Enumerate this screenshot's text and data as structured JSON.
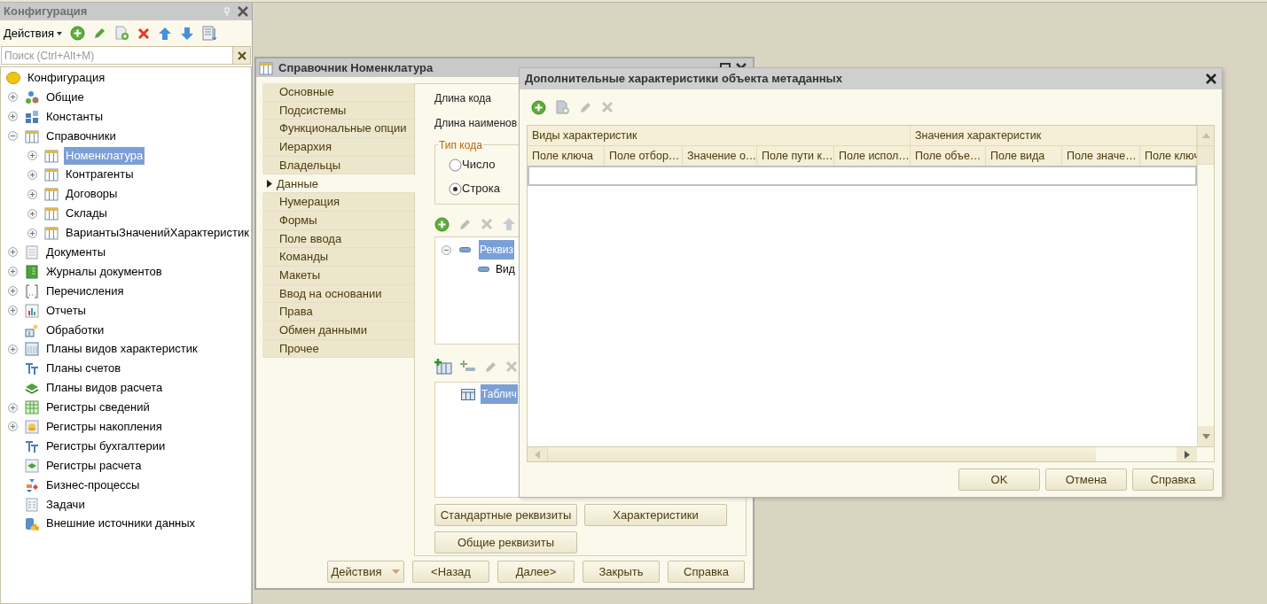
{
  "config_panel": {
    "title": "Конфигурация",
    "actions_label": "Действия",
    "search": {
      "placeholder": "Поиск (Ctrl+Alt+M)"
    },
    "tree": {
      "label": "Конфигурация",
      "kind": "root",
      "selected": false,
      "children": [
        {
          "label": "Общие",
          "kind": "common",
          "expandable": true,
          "expanded": false,
          "selected": false
        },
        {
          "label": "Константы",
          "kind": "constants",
          "expandable": true,
          "expanded": false,
          "selected": false
        },
        {
          "label": "Справочники",
          "kind": "catalog",
          "expandable": true,
          "expanded": true,
          "selected": false,
          "children": [
            {
              "label": "Номенклатура",
              "kind": "catalog",
              "expandable": true,
              "expanded": false,
              "selected": true
            },
            {
              "label": "Контрагенты",
              "kind": "catalog",
              "expandable": true,
              "expanded": false,
              "selected": false
            },
            {
              "label": "Договоры",
              "kind": "catalog",
              "expandable": true,
              "expanded": false,
              "selected": false
            },
            {
              "label": "Склады",
              "kind": "catalog",
              "expandable": true,
              "expanded": false,
              "selected": false
            },
            {
              "label": "ВариантыЗначенийХарактеристик",
              "kind": "catalog",
              "expandable": true,
              "expanded": false,
              "selected": false
            }
          ]
        },
        {
          "label": "Документы",
          "kind": "document",
          "expandable": true,
          "expanded": false,
          "selected": false
        },
        {
          "label": "Журналы документов",
          "kind": "journal",
          "expandable": true,
          "expanded": false,
          "selected": false
        },
        {
          "label": "Перечисления",
          "kind": "enum",
          "expandable": true,
          "expanded": false,
          "selected": false
        },
        {
          "label": "Отчеты",
          "kind": "report",
          "expandable": true,
          "expanded": false,
          "selected": false
        },
        {
          "label": "Обработки",
          "kind": "processing",
          "expandable": false,
          "selected": false
        },
        {
          "label": "Планы видов характеристик",
          "kind": "chartchar",
          "expandable": true,
          "expanded": false,
          "selected": false
        },
        {
          "label": "Планы счетов",
          "kind": "accounts",
          "expandable": false,
          "selected": false
        },
        {
          "label": "Планы видов расчета",
          "kind": "calctypes",
          "expandable": false,
          "selected": false
        },
        {
          "label": "Регистры сведений",
          "kind": "inforeg",
          "expandable": true,
          "expanded": false,
          "selected": false
        },
        {
          "label": "Регистры накопления",
          "kind": "accumreg",
          "expandable": true,
          "expanded": false,
          "selected": false
        },
        {
          "label": "Регистры бухгалтерии",
          "kind": "accounts",
          "expandable": false,
          "selected": false
        },
        {
          "label": "Регистры расчета",
          "kind": "calcreg",
          "expandable": false,
          "selected": false
        },
        {
          "label": "Бизнес-процессы",
          "kind": "bizproc",
          "expandable": false,
          "selected": false
        },
        {
          "label": "Задачи",
          "kind": "task",
          "expandable": false,
          "selected": false
        },
        {
          "label": "Внешние источники данных",
          "kind": "external",
          "expandable": false,
          "selected": false
        }
      ]
    }
  },
  "catalog_window": {
    "title": "Справочник Номенклатура",
    "tabs": [
      {
        "label": "Основные",
        "selected": false
      },
      {
        "label": "Подсистемы",
        "selected": false
      },
      {
        "label": "Функциональные опции",
        "selected": false
      },
      {
        "label": "Иерархия",
        "selected": false
      },
      {
        "label": "Владельцы",
        "selected": false
      },
      {
        "label": "Данные",
        "selected": true
      },
      {
        "label": "Нумерация",
        "selected": false
      },
      {
        "label": "Формы",
        "selected": false
      },
      {
        "label": "Поле ввода",
        "selected": false
      },
      {
        "label": "Команды",
        "selected": false
      },
      {
        "label": "Макеты",
        "selected": false
      },
      {
        "label": "Ввод на основании",
        "selected": false
      },
      {
        "label": "Права",
        "selected": false
      },
      {
        "label": "Обмен данными",
        "selected": false
      },
      {
        "label": "Прочее",
        "selected": false
      }
    ],
    "fields": [
      {
        "label": "Длина кода"
      },
      {
        "label": "Длина наименов"
      }
    ],
    "code_type": {
      "title": "Тип кода",
      "options": [
        {
          "label": "Число",
          "selected": false
        },
        {
          "label": "Строка",
          "selected": true
        }
      ]
    },
    "attributes": [
      {
        "label": "Реквиз",
        "expanded": true,
        "selected": true,
        "children": [
          {
            "label": "Вид",
            "selected": false
          }
        ]
      }
    ],
    "tabular_sections": [
      {
        "label": "Таблич",
        "selected": true
      }
    ],
    "buttons": [
      {
        "label": "Стандартные реквизиты"
      },
      {
        "label": "Характеристики"
      },
      {
        "label": "Общие реквизиты"
      }
    ],
    "footer_buttons": [
      {
        "label": "Действия",
        "kind": "dropdown"
      },
      {
        "label": "<Назад",
        "kind": "plain"
      },
      {
        "label": "Далее>",
        "kind": "plain"
      },
      {
        "label": "Закрыть",
        "kind": "plain"
      },
      {
        "label": "Справка",
        "kind": "plain"
      }
    ]
  },
  "dialog": {
    "title": "Дополнительные характеристики объекта метаданных",
    "groups": [
      {
        "label": "Виды характеристик",
        "columns": [
          "Поле ключа",
          "Поле отбор…",
          "Значение о…",
          "Поле пути к…",
          "Поле испол…"
        ]
      },
      {
        "label": "Значения характеристик",
        "columns": [
          "Поле объе…",
          "Поле вида",
          "Поле значе…",
          "Поле ключ"
        ]
      }
    ],
    "buttons": [
      "OK",
      "Отмена",
      "Справка"
    ]
  }
}
